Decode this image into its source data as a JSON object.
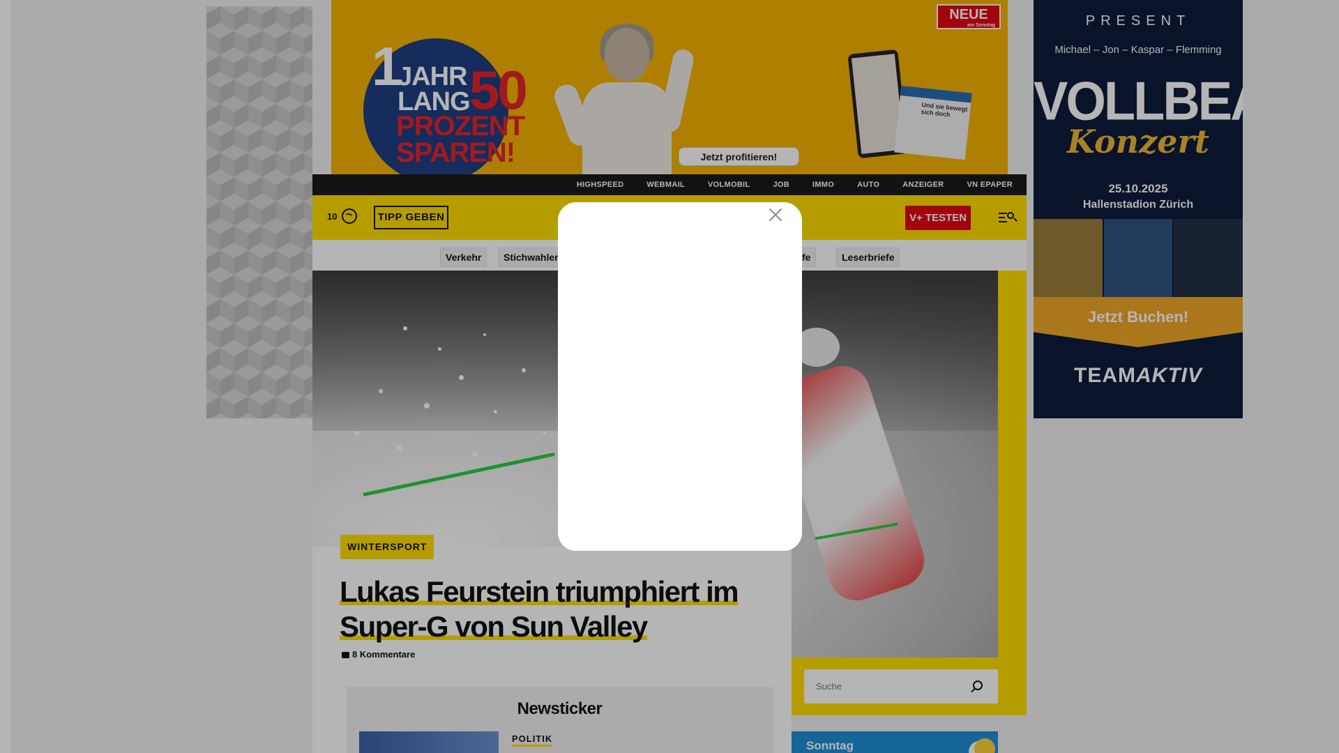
{
  "top_ad": {
    "big_number": "1",
    "line_jahr": "JAHR",
    "line_lang": "LANG",
    "big_percent": "50",
    "line_prozent": "PROZENT",
    "line_sparen": "SPAREN!",
    "cta": "Jetzt profitieren!",
    "logo": "NEUE",
    "logo_sub": "am Sonntag",
    "paper_headline": "Und sie bewegt sich doch"
  },
  "right_ad": {
    "present": "PRESENT",
    "names": "Michael – Jon – Kaspar – Flemming",
    "title": "VOLLBEAT",
    "subtitle": "Konzert",
    "date": "25.10.2025",
    "venue": "Hallenstadion Zürich",
    "cta": "Jetzt Buchen!",
    "brand_a": "TEAM",
    "brand_b": "AKTIV"
  },
  "utility_nav": [
    "HIGHSPEED",
    "WEBMAIL",
    "VOLMOBIL",
    "JOB",
    "IMMO",
    "AUTO",
    "ANZEIGER",
    "VN EPAPER"
  ],
  "header": {
    "temperature": "10",
    "weather_icon": "cloud-icon",
    "tipp_label": "TIPP GEBEN",
    "vplus_label": "V+ TESTEN",
    "menu_icon": "menu-search-icon"
  },
  "subnav": {
    "items": [
      "Verkehr",
      "Stichwahlen",
      "rufe",
      "Leserbriefe"
    ]
  },
  "article": {
    "category": "WINTERSPORT",
    "headline_line1": "Lukas Feurstein triumphiert im",
    "headline_line2": "Super-G von Sun Valley",
    "comments": "8 Kommentare"
  },
  "newsticker": {
    "title": "Newsticker",
    "first_category": "POLITIK"
  },
  "search": {
    "placeholder": "Suche"
  },
  "weather_widget": {
    "day": "Sonntag"
  },
  "modal": {
    "close_icon": "close-icon"
  },
  "colors": {
    "brand_yellow": "#ffde00",
    "brand_red": "#e30613",
    "dark_bar": "#1a1a1a",
    "overlay": "rgba(0,0,0,0.29)"
  }
}
